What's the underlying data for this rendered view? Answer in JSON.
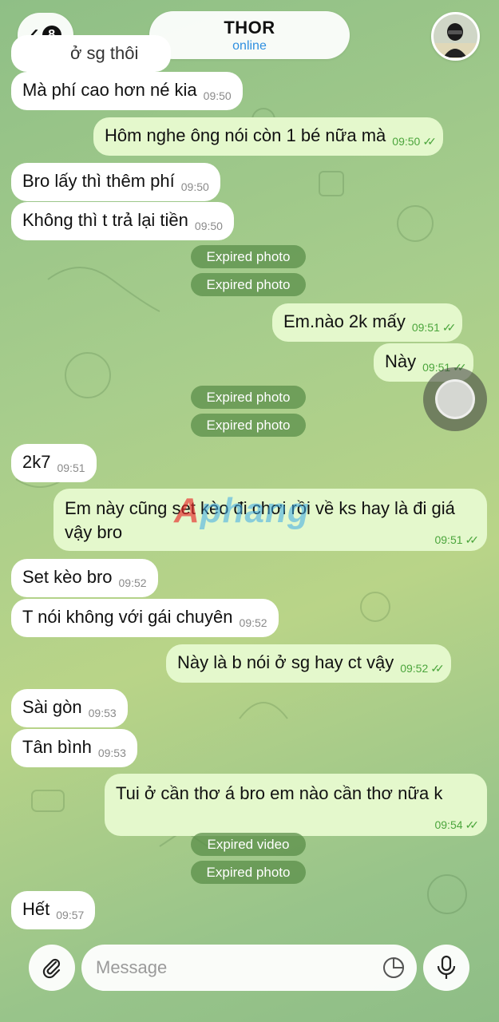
{
  "header": {
    "back_badge": "8",
    "contact_name": "THOR",
    "status": "online"
  },
  "messages": [
    {
      "text": "Mà phí cao hơn né kia",
      "time": "09:50",
      "dir": "in"
    },
    {
      "text": "Hôm nghe ông nói còn 1 bé nữa mà",
      "time": "09:50",
      "dir": "out"
    },
    {
      "text": "Bro lấy thì thêm phí",
      "time": "09:50",
      "dir": "in"
    },
    {
      "text": "Không thì t trả lại tiền",
      "time": "09:50",
      "dir": "in"
    },
    {
      "text": "Em.nào 2k mấy",
      "time": "09:51",
      "dir": "out"
    },
    {
      "text": "Này",
      "time": "09:51",
      "dir": "out"
    },
    {
      "text": "2k7",
      "time": "09:51",
      "dir": "in"
    },
    {
      "text": "Em này cũng set kèo đi chơi rồi về ks hay là đi giá vậy bro",
      "time": "09:51",
      "dir": "out"
    },
    {
      "text": "Set kèo bro",
      "time": "09:52",
      "dir": "in"
    },
    {
      "text": "T nói không với gái chuyên",
      "time": "09:52",
      "dir": "in"
    },
    {
      "text": "Này là b nói ở sg hay ct vậy",
      "time": "09:52",
      "dir": "out"
    },
    {
      "text": "Sài gòn",
      "time": "09:53",
      "dir": "in"
    },
    {
      "text": "Tân bình",
      "time": "09:53",
      "dir": "in"
    },
    {
      "text": "Tui ở cần thơ á bro em nào cần thơ nữa k",
      "time": "09:54",
      "dir": "out"
    },
    {
      "text": "Hết",
      "time": "09:57",
      "dir": "in"
    }
  ],
  "partial_top": {
    "text": "ở sg thôi"
  },
  "service": {
    "expired_photo": "Expired photo",
    "expired_video": "Expired video"
  },
  "watermark": {
    "a": "A",
    "rest": "phang"
  },
  "composer": {
    "placeholder": "Message"
  },
  "colors": {
    "incoming_bubble": "#ffffff",
    "outgoing_bubble": "#e4f8cc",
    "time_outgoing": "#4ba53c",
    "status_blue": "#2f8fe0"
  }
}
